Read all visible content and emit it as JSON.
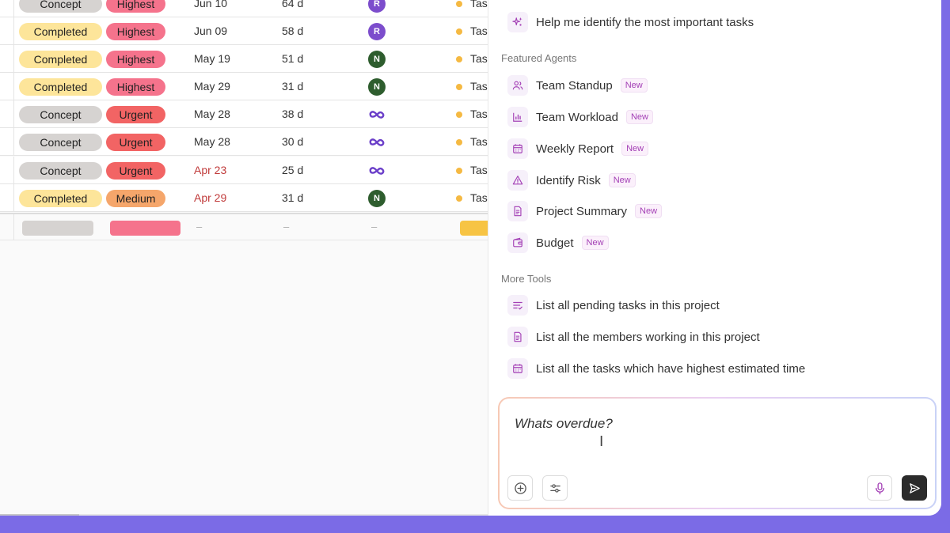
{
  "table": {
    "rows": [
      {
        "status": "Concept",
        "status_kind": "concept",
        "priority": "Highest",
        "priority_kind": "highest",
        "date": "Jun 10",
        "overdue": false,
        "duration": "64 d",
        "assignee": "R",
        "assignee_kind": "r",
        "task": "Tas"
      },
      {
        "status": "Completed",
        "status_kind": "completed",
        "priority": "Highest",
        "priority_kind": "highest",
        "date": "Jun 09",
        "overdue": false,
        "duration": "58 d",
        "assignee": "R",
        "assignee_kind": "r",
        "task": "Tas"
      },
      {
        "status": "Completed",
        "status_kind": "completed",
        "priority": "Highest",
        "priority_kind": "highest",
        "date": "May 19",
        "overdue": false,
        "duration": "51 d",
        "assignee": "N",
        "assignee_kind": "n",
        "task": "Tas"
      },
      {
        "status": "Completed",
        "status_kind": "completed",
        "priority": "Highest",
        "priority_kind": "highest",
        "date": "May 29",
        "overdue": false,
        "duration": "31 d",
        "assignee": "N",
        "assignee_kind": "n",
        "task": "Tas"
      },
      {
        "status": "Concept",
        "status_kind": "concept",
        "priority": "Urgent",
        "priority_kind": "urgent",
        "date": "May 28",
        "overdue": false,
        "duration": "38 d",
        "assignee": "",
        "assignee_kind": "infinity",
        "task": "Tas"
      },
      {
        "status": "Concept",
        "status_kind": "concept",
        "priority": "Urgent",
        "priority_kind": "urgent",
        "date": "May 28",
        "overdue": false,
        "duration": "30 d",
        "assignee": "",
        "assignee_kind": "infinity",
        "task": "Tas"
      },
      {
        "status": "Concept",
        "status_kind": "concept",
        "priority": "Urgent",
        "priority_kind": "urgent",
        "date": "Apr 23",
        "overdue": true,
        "duration": "25 d",
        "assignee": "",
        "assignee_kind": "infinity",
        "task": "Tas"
      },
      {
        "status": "Completed",
        "status_kind": "completed",
        "priority": "Medium",
        "priority_kind": "medium",
        "date": "Apr 29",
        "overdue": true,
        "duration": "31 d",
        "assignee": "N",
        "assignee_kind": "n",
        "task": "Tas"
      }
    ],
    "summary": {
      "date": "–",
      "duration": "–",
      "assignee": "–"
    }
  },
  "panel": {
    "top_suggestion": {
      "label": "Help me identify the most important tasks",
      "icon": "sparkle-icon"
    },
    "featured_title": "Featured Agents",
    "agents": [
      {
        "label": "Team Standup",
        "badge": "New",
        "icon": "users-icon"
      },
      {
        "label": "Team Workload",
        "badge": "New",
        "icon": "bar-chart-icon"
      },
      {
        "label": "Weekly Report",
        "badge": "New",
        "icon": "calendar-icon"
      },
      {
        "label": "Identify Risk",
        "badge": "New",
        "icon": "warning-icon"
      },
      {
        "label": "Project Summary",
        "badge": "New",
        "icon": "document-icon"
      },
      {
        "label": "Budget",
        "badge": "New",
        "icon": "wallet-icon"
      }
    ],
    "tools_title": "More Tools",
    "tools": [
      {
        "label": "List all pending tasks in this project",
        "icon": "list-check-icon"
      },
      {
        "label": "List all the members working in this project",
        "icon": "document-icon"
      },
      {
        "label": "List all the tasks which have highest estimated time",
        "icon": "calendar-icon"
      }
    ],
    "composer": {
      "text": "Whats overdue?"
    }
  },
  "colors": {
    "accent": "#a33fb5",
    "background": "#7b6be6",
    "overdue": "#c03a3a"
  }
}
